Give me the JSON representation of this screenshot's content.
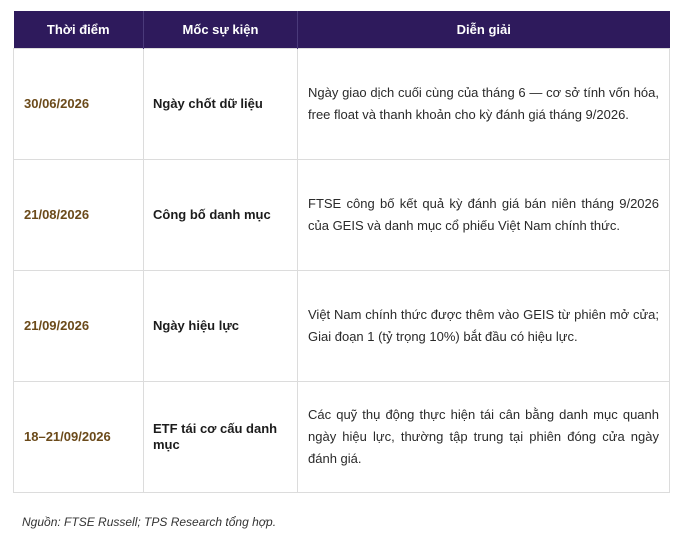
{
  "table": {
    "headers": [
      "Thời điểm",
      "Mốc sự kiện",
      "Diễn giải"
    ],
    "rows": [
      {
        "date": "30/06/2026",
        "event": "Ngày chốt dữ liệu",
        "description": "Ngày giao dịch cuối cùng của tháng 6 — cơ sở tính vốn hóa, free float và thanh khoản cho kỳ đánh giá tháng 9/2026."
      },
      {
        "date": "21/08/2026",
        "event": "Công bố danh mục",
        "description": "FTSE công bố kết quả kỳ đánh giá bán niên tháng 9/2026 của GEIS và danh mục cổ phiếu Việt Nam chính thức."
      },
      {
        "date": "21/09/2026",
        "event": "Ngày hiệu lực",
        "description": "Việt Nam chính thức được thêm vào GEIS từ phiên mở cửa; Giai đoạn 1 (tỷ trọng 10%) bắt đầu có hiệu lực."
      },
      {
        "date": "18–21/09/2026",
        "event": "ETF tái cơ cấu danh mục",
        "description": "Các quỹ thụ động thực hiện tái cân bằng danh mục quanh ngày hiệu lực, thường tập trung tại phiên đóng cửa ngày đánh giá."
      }
    ]
  },
  "source_note": "Nguồn: FTSE Russell; TPS Research tổng hợp.",
  "colors": {
    "header_bg": "#2e1a5c",
    "date_text": "#6b4a1a"
  }
}
